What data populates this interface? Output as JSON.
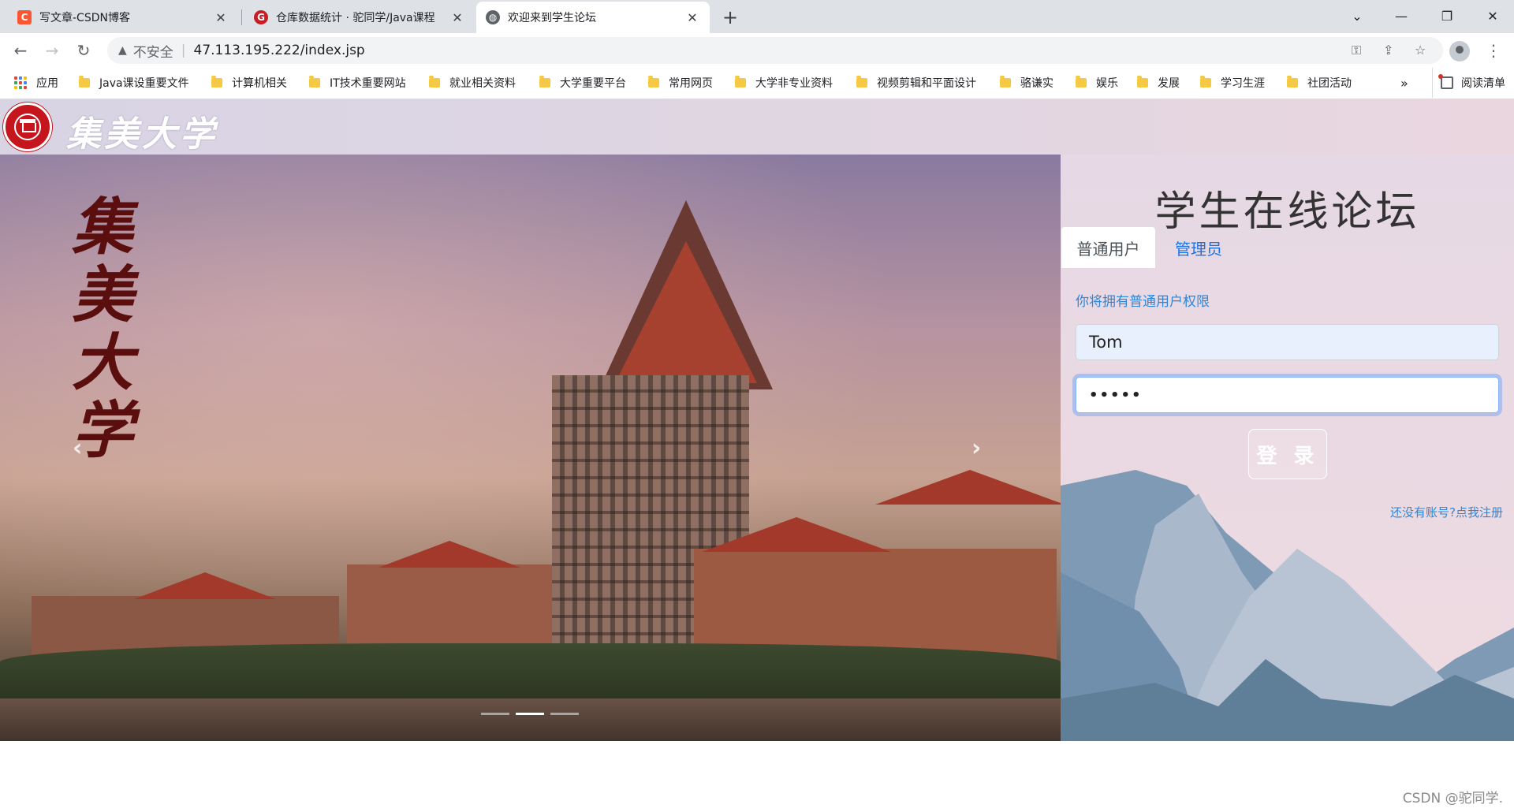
{
  "tabs": [
    {
      "title": "写文章-CSDN博客",
      "favicon": "csdn-icon",
      "color": "#fc5531",
      "glyph": "C"
    },
    {
      "title": "仓库数据统计 · 驼同学/Java课程",
      "favicon": "gitee-icon",
      "color": "#c71d23",
      "glyph": "G"
    },
    {
      "title": "欢迎来到学生论坛",
      "favicon": "globe-icon",
      "color": "#5f6368",
      "glyph": "◍"
    }
  ],
  "address": {
    "security": "不安全",
    "url": "47.113.195.222/index.jsp"
  },
  "bookmarks": {
    "apps": "应用",
    "items": [
      "Java课设重要文件",
      "计算机相关",
      "IT技术重要网站",
      "就业相关资料",
      "大学重要平台",
      "常用网页",
      "大学非专业资料",
      "视频剪辑和平面设计",
      "骆谦实",
      "娱乐",
      "发展",
      "学习生涯",
      "社团活动"
    ],
    "overflow": "»",
    "reading_list": "阅读清单"
  },
  "site": {
    "logo_text": "集美大学",
    "carousel_calligraphy": "集美大学",
    "forum_title": "学生在线论坛",
    "tab_user": "普通用户",
    "tab_admin": "管理员",
    "hint": "你将拥有普通用户权限",
    "username_value": "Tom",
    "password_value": "•••••",
    "login_label": "登 录",
    "register_link": "还没有账号?点我注册"
  },
  "watermark": "CSDN @驼同学.",
  "colors": {
    "accent": "#1a73e8",
    "link": "#2f86d6",
    "brand_red": "#c5161d"
  }
}
